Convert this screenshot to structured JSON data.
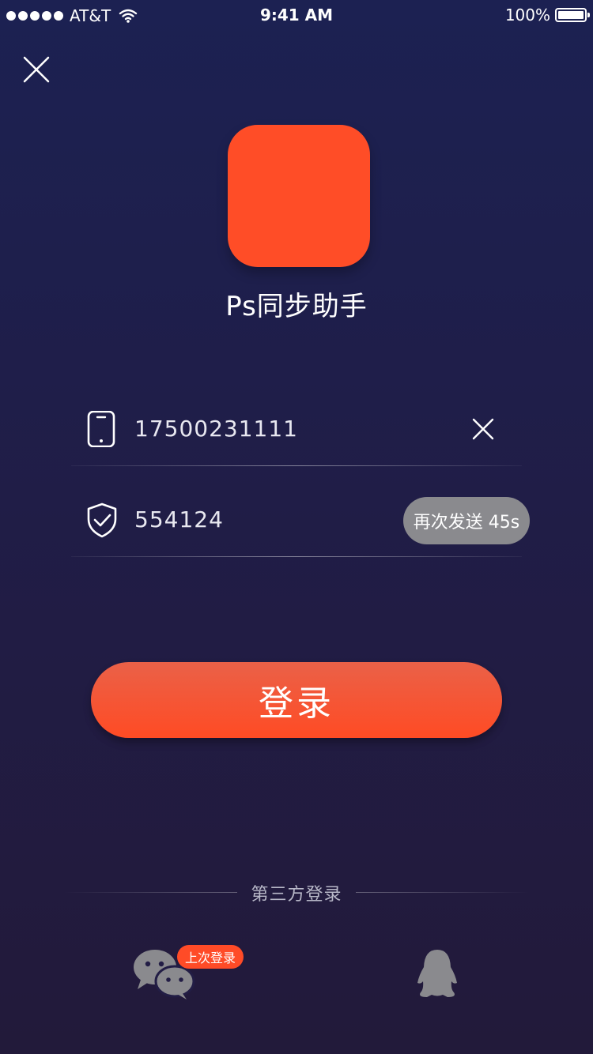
{
  "status_bar": {
    "carrier": "AT&T",
    "time": "9:41 AM",
    "battery": "100%",
    "signal_bars": 5
  },
  "app": {
    "name": "Ps同步助手",
    "icon_color": "#ff4d27"
  },
  "form": {
    "phone_value": "17500231111",
    "code_value": "554124",
    "resend_label": "再次发送 45s"
  },
  "login_button": {
    "label": "登录"
  },
  "third_party": {
    "label": "第三方登录",
    "last_login_badge": "上次登录",
    "providers": [
      "wechat",
      "qq"
    ]
  },
  "colors": {
    "accent": "#ff4b27",
    "background_top": "#1c2152",
    "background_bottom": "#221a3a",
    "icon_gray": "#8a8a8e"
  }
}
